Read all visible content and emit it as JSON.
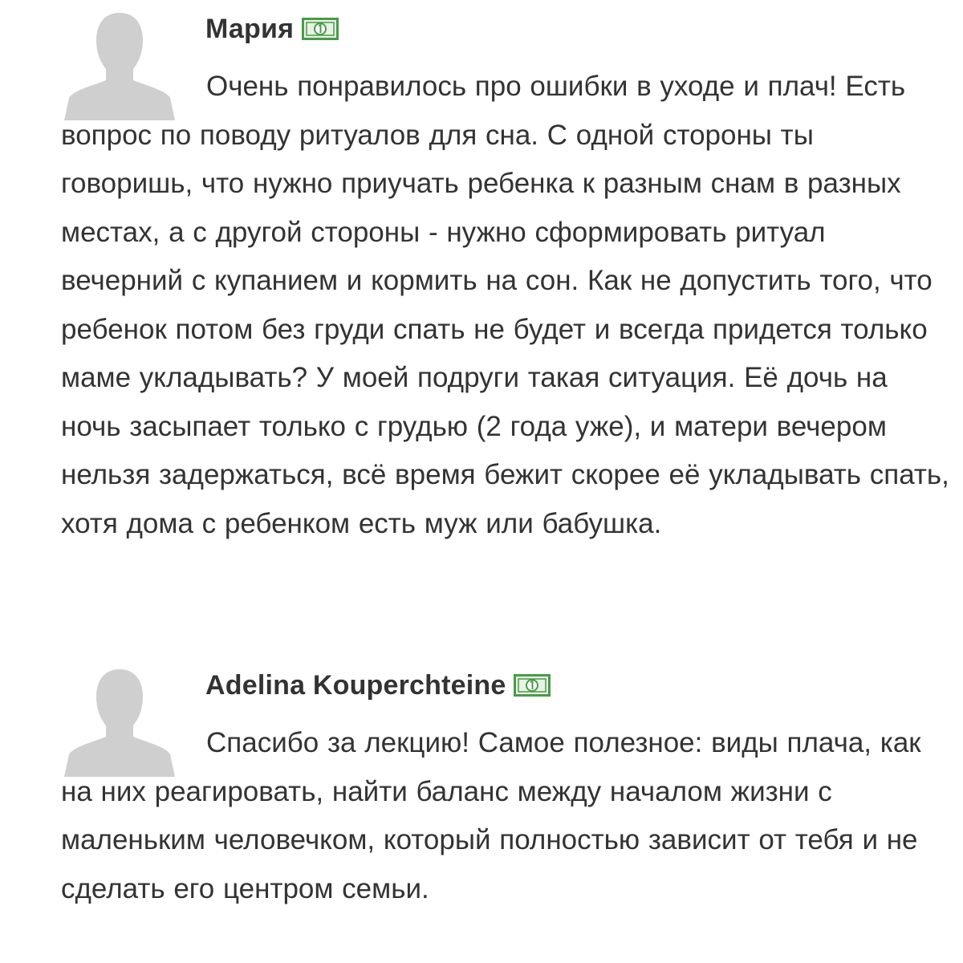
{
  "comments": [
    {
      "author": "Мария",
      "badge_icon": "money-bill-icon",
      "avatar_icon": "default-user-silhouette-icon",
      "text": "Очень понравилось про ошибки в уходе и плач! Есть вопрос по поводу ритуалов для сна. С одной стороны ты говоришь, что нужно приучать ребенка к разным снам в разных местах, а с другой стороны - нужно сформировать ритуал вечерний с купанием и кормить на сон. Как не допустить того, что ребенок потом без груди спать не будет и всегда придется только маме укладывать? У моей подруги такая ситуация. Её дочь на ночь засыпает только с грудью (2 года уже), и матери вечером нельзя задержаться, всё время бежит скорее её укладывать спать, хотя дома с ребенком есть муж или бабушка."
    },
    {
      "author": "Adelina Kouperchteine",
      "badge_icon": "money-bill-icon",
      "avatar_icon": "default-user-silhouette-icon",
      "text": "Спасибо за лекцию! Самое полезное: виды плача, как на них реагировать, найти баланс между началом жизни с маленьким человечком, который полностью зависит от тебя и не сделать его центром семьи."
    }
  ],
  "colors": {
    "text": "#333333",
    "avatar": "#cfcfcf",
    "badge_green": "#4a9a4a",
    "badge_fill": "#e8f3e3"
  }
}
